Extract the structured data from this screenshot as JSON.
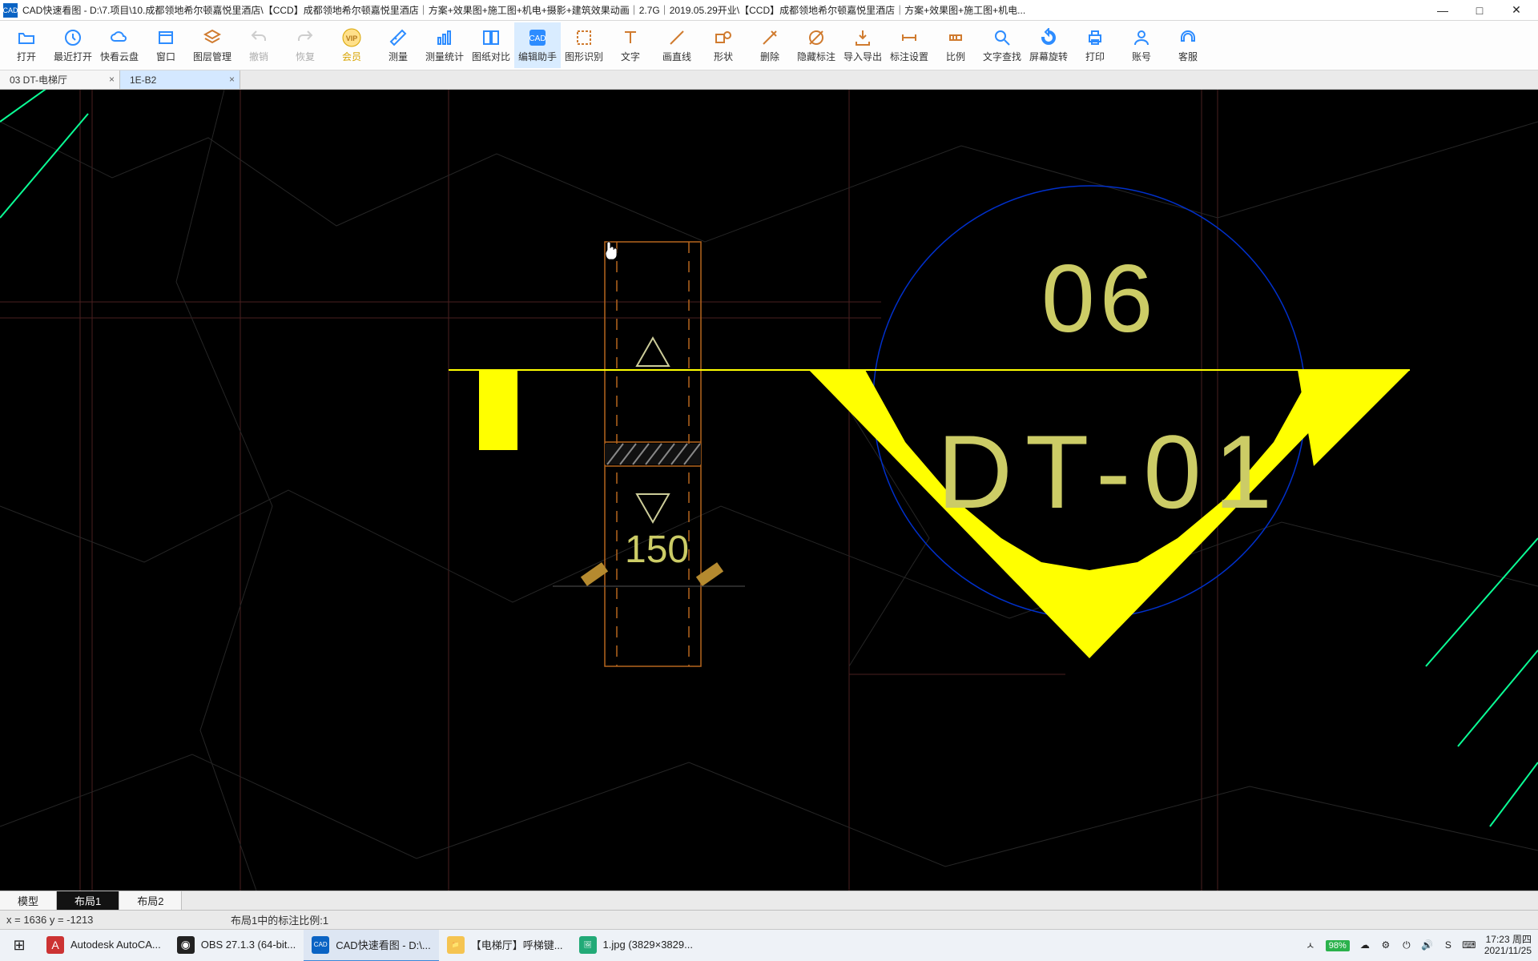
{
  "app": {
    "name": "CAD快速看图",
    "title": "CAD快速看图 - D:\\7.项目\\10.成都领地希尔顿嘉悦里酒店\\【CCD】成都领地希尔顿嘉悦里酒店｜方案+效果图+施工图+机电+摄影+建筑效果动画｜2.7G｜2019.05.29开业\\【CCD】成都领地希尔顿嘉悦里酒店｜方案+效果图+施工图+机电...",
    "icon_label": "CAD"
  },
  "window_buttons": {
    "min": "—",
    "max": "□",
    "close": "✕"
  },
  "toolbar": [
    {
      "id": "open",
      "label": "打开",
      "color": "#2d8cff"
    },
    {
      "id": "recent",
      "label": "最近打开",
      "color": "#2d8cff"
    },
    {
      "id": "cloud",
      "label": "快看云盘",
      "color": "#2d8cff"
    },
    {
      "id": "window",
      "label": "窗口",
      "color": "#2d8cff"
    },
    {
      "id": "layers",
      "label": "图层管理",
      "color": "#d07b2f"
    },
    {
      "id": "undo",
      "label": "撤销",
      "color": "#888",
      "disabled": true
    },
    {
      "id": "redo",
      "label": "恢复",
      "color": "#888",
      "disabled": true
    },
    {
      "id": "vip",
      "label": "会员",
      "color": "#d8a400",
      "vip": true
    },
    {
      "id": "measure",
      "label": "测量",
      "color": "#2d8cff"
    },
    {
      "id": "measure-stat",
      "label": "测量统计",
      "color": "#2d8cff"
    },
    {
      "id": "compare",
      "label": "图纸对比",
      "color": "#2d8cff"
    },
    {
      "id": "edit-helper",
      "label": "编辑助手",
      "color": "#2d8cff",
      "highlight": true
    },
    {
      "id": "shape-ident",
      "label": "图形识别",
      "color": "#d07b2f"
    },
    {
      "id": "text",
      "label": "文字",
      "color": "#d07b2f"
    },
    {
      "id": "line",
      "label": "画直线",
      "color": "#d07b2f"
    },
    {
      "id": "shape",
      "label": "形状",
      "color": "#d07b2f"
    },
    {
      "id": "delete",
      "label": "删除",
      "color": "#d07b2f"
    },
    {
      "id": "hide-ann",
      "label": "隐藏标注",
      "color": "#d07b2f"
    },
    {
      "id": "import-export",
      "label": "导入导出",
      "color": "#d07b2f"
    },
    {
      "id": "ann-setting",
      "label": "标注设置",
      "color": "#d07b2f"
    },
    {
      "id": "scale",
      "label": "比例",
      "color": "#d07b2f"
    },
    {
      "id": "find-text",
      "label": "文字查找",
      "color": "#2d8cff"
    },
    {
      "id": "rotate",
      "label": "屏幕旋转",
      "color": "#2d8cff"
    },
    {
      "id": "print",
      "label": "打印",
      "color": "#2d8cff"
    },
    {
      "id": "account",
      "label": "账号",
      "color": "#2d8cff"
    },
    {
      "id": "service",
      "label": "客服",
      "color": "#2d8cff"
    }
  ],
  "doc_tabs": [
    {
      "label": "03 DT-电梯厅",
      "active": false
    },
    {
      "label": "1E-B2",
      "active": true
    }
  ],
  "drawing": {
    "dim_value": "150",
    "marker_top": "06",
    "marker_main": "DT-01"
  },
  "layout_tabs": [
    {
      "label": "模型",
      "active": false
    },
    {
      "label": "布局1",
      "active": true
    },
    {
      "label": "布局2",
      "active": false
    }
  ],
  "status": {
    "coord": "x = 1636  y = -1213",
    "scale": "布局1中的标注比例:1"
  },
  "taskbar": {
    "tasks": [
      {
        "label": "Autodesk AutoCA...",
        "color": "#c33",
        "icon": "A"
      },
      {
        "label": "OBS 27.1.3 (64-bit...",
        "color": "#222",
        "icon": "◉"
      },
      {
        "label": "CAD快速看图 - D:\\...",
        "color": "#0a63c4",
        "icon": "CAD",
        "active": true
      },
      {
        "label": "【电梯厅】呼梯键...",
        "color": "#f5c451",
        "icon": "📁"
      },
      {
        "label": "1.jpg  (3829×3829...",
        "color": "#2a7",
        "icon": "🖼"
      }
    ],
    "tray": {
      "battery": "98%",
      "up": "ㅅ",
      "icons": [
        "☁",
        "⚙",
        "⏻",
        "🔊",
        "S",
        "⌨"
      ],
      "time": "17:23 周四",
      "date": "2021/11/25"
    }
  }
}
